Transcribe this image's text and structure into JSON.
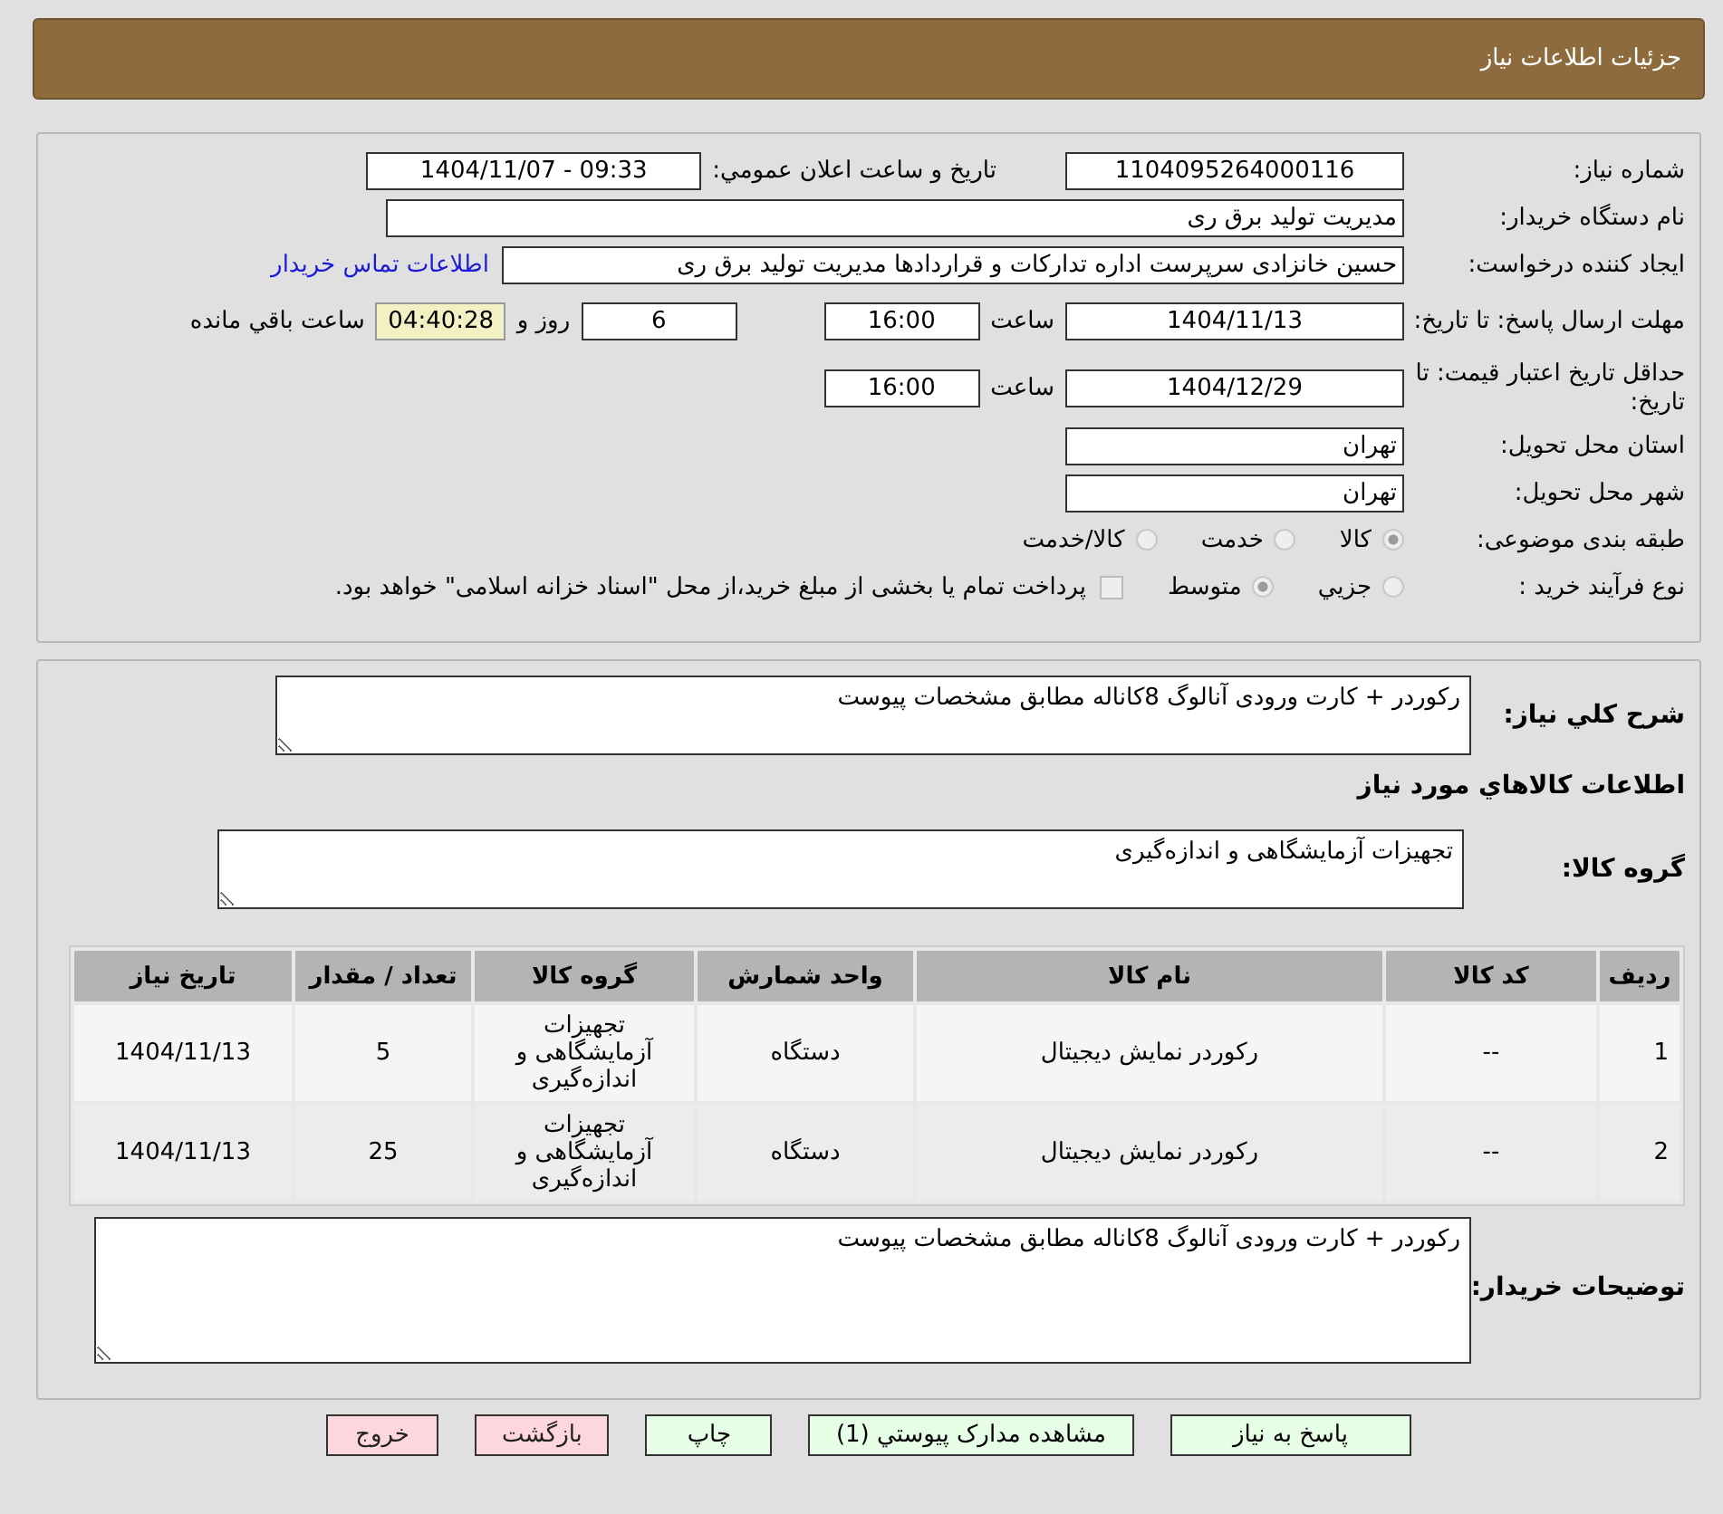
{
  "header": {
    "title": "جزئیات اطلاعات نیاز"
  },
  "need_number": {
    "label": "شماره نیاز:",
    "value": "1104095264000116"
  },
  "announce": {
    "label": "تاریخ و ساعت اعلان عمومي:",
    "value": "1404/11/07 - 09:33"
  },
  "buyer_org": {
    "label": "نام دستگاه خریدار:",
    "value": "مدیریت تولید برق ری"
  },
  "creator": {
    "label": "ایجاد کننده درخواست:",
    "value": "حسین خانزادی سرپرست اداره تدارکات و قراردادها مدیریت تولید برق ری",
    "link": "اطلاعات تماس خریدار"
  },
  "deadline": {
    "label": "مهلت ارسال پاسخ: تا تاریخ:",
    "date": "1404/11/13",
    "time_label": "ساعت",
    "time": "16:00",
    "days": "6",
    "days_label": "روز و",
    "remaining": "04:40:28",
    "remaining_label": "ساعت باقي مانده"
  },
  "validity": {
    "label": "حداقل تاریخ اعتبار قیمت: تا تاریخ:",
    "date": "1404/12/29",
    "time_label": "ساعت",
    "time": "16:00"
  },
  "province": {
    "label": "استان محل تحویل:",
    "value": "تهران"
  },
  "city": {
    "label": "شهر محل تحویل:",
    "value": "تهران"
  },
  "category": {
    "label": "طبقه بندی موضوعی:",
    "options": [
      {
        "label": "کالا",
        "selected": true
      },
      {
        "label": "خدمت",
        "selected": false
      },
      {
        "label": "کالا/خدمت",
        "selected": false
      }
    ]
  },
  "process": {
    "label": "نوع فرآیند خرید :",
    "options": [
      {
        "label": "جزيي",
        "selected": false
      },
      {
        "label": "متوسط",
        "selected": true
      }
    ],
    "treasury": {
      "label": "پرداخت تمام یا بخشی از مبلغ خرید،از محل \"اسناد خزانه اسلامی\" خواهد بود.",
      "checked": false
    }
  },
  "summary": {
    "label": "شرح کلي نیاز:",
    "value": "رکوردر + کارت ورودی آنالوگ 8کاناله مطابق مشخصات پیوست"
  },
  "goods_heading": "اطلاعات کالاهاي مورد نیاز",
  "goods_group": {
    "label": "گروه کالا:",
    "value": "تجهیزات آزمایشگاهی و اندازه‌گیری"
  },
  "table": {
    "columns": [
      "ردیف",
      "کد کالا",
      "نام کالا",
      "واحد شمارش",
      "گروه کالا",
      "تعداد / مقدار",
      "تاریخ نیاز"
    ],
    "rows": [
      [
        "1",
        "--",
        "رکوردر نمایش دیجیتال",
        "دستگاه",
        "تجهیزات آزمایشگاهی و اندازه‌گیری",
        "5",
        "1404/11/13"
      ],
      [
        "2",
        "--",
        "رکوردر نمایش دیجیتال",
        "دستگاه",
        "تجهیزات آزمایشگاهی و اندازه‌گیری",
        "25",
        "1404/11/13"
      ]
    ]
  },
  "buyer_notes": {
    "label": "توضیحات خریدار:",
    "value": "رکوردر + کارت ورودی آنالوگ 8کاناله مطابق مشخصات پیوست"
  },
  "buttons": [
    {
      "label": "پاسخ به نیاز",
      "kind": "primary"
    },
    {
      "label": "مشاهده مدارک پیوستي (1)",
      "kind": "primary"
    },
    {
      "label": "چاپ",
      "kind": "primary"
    },
    {
      "label": "بازگشت",
      "kind": "danger"
    },
    {
      "label": "خروج",
      "kind": "danger"
    }
  ]
}
